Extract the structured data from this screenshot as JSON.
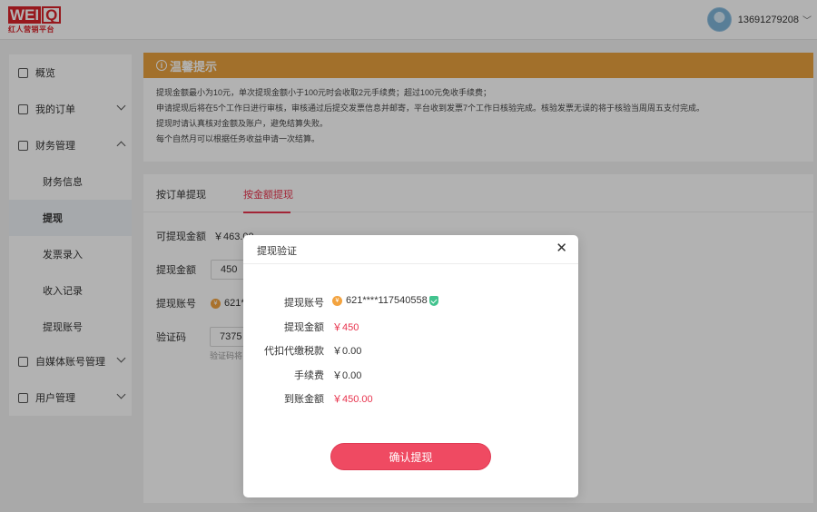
{
  "header": {
    "logo_main_left": "WEI",
    "logo_main_right": "Q",
    "logo_sub": "红人营销平台",
    "username": "13691279208"
  },
  "sidebar": {
    "items": [
      {
        "label": "概览"
      },
      {
        "label": "我的订单"
      },
      {
        "label": "财务管理"
      },
      {
        "label": "财务信息"
      },
      {
        "label": "提现"
      },
      {
        "label": "发票录入"
      },
      {
        "label": "收入记录"
      },
      {
        "label": "提现账号"
      },
      {
        "label": "自媒体账号管理"
      },
      {
        "label": "用户管理"
      }
    ]
  },
  "notice": {
    "title": "温馨提示",
    "lines": [
      "提现金额最小为10元，单次提现金额小于100元时会收取2元手续费；超过100元免收手续费；",
      "申请提现后将在5个工作日进行审核，审核通过后提交发票信息并邮寄，平台收到发票7个工作日核验完成。核验发票无误的将于核验当周周五支付完成。",
      "提现时请认真核对金额及账户，避免结算失败。",
      "每个自然月可以根据任务收益申请一次结算。"
    ]
  },
  "main": {
    "tabs": [
      {
        "label": "按订单提现"
      },
      {
        "label": "按金额提现"
      }
    ],
    "available_label": "可提现金额",
    "available_value": "￥463.00",
    "amount_label": "提现金额",
    "amount_value": "450",
    "account_label": "提现账号",
    "account_value": "621*",
    "code_label": "验证码",
    "code_value": "7375",
    "code_hint": "验证码将"
  },
  "modal": {
    "title": "提现验证",
    "rows": [
      {
        "label": "提现账号",
        "value": "621****117540558"
      },
      {
        "label": "提现金额",
        "value": "￥450"
      },
      {
        "label": "代扣代缴税款",
        "value": "￥0.00"
      },
      {
        "label": "手续费",
        "value": "￥0.00"
      },
      {
        "label": "到账金额",
        "value": "￥450.00"
      }
    ],
    "confirm_label": "确认提现"
  },
  "colors": {
    "accent": "#e8344e",
    "notice_bar": "#e8a13e",
    "brand": "#d8232a"
  }
}
